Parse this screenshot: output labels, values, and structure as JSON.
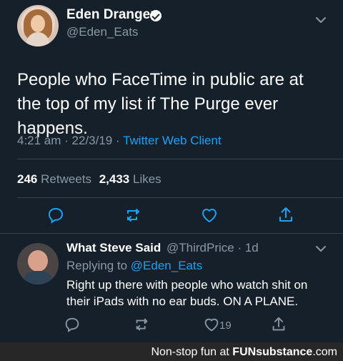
{
  "tweet": {
    "author_name": "Eden Dranger",
    "author_handle": "@Eden_Eats",
    "text": "People who FaceTime in public are at the top of my list if The Purge ever happens.",
    "timestamp": "4:21 am · 22/3/19 ·",
    "client": "Twitter Web Client",
    "retweets_count": "246",
    "retweets_label": "Retweets",
    "likes_count": "2,433",
    "likes_label": "Likes",
    "actions": [
      "reply-icon",
      "retweet-icon",
      "heart-icon",
      "share-icon"
    ]
  },
  "reply": {
    "author_name": "What Steve Said",
    "author_handle": "@ThirdPrice · 1d",
    "replying_label": "Replying to",
    "replying_to": "@Eden_Eats",
    "text": "Right up there with people who watch shit on their iPads with no ear buds. ON A PLANE.",
    "likes_count": "19",
    "actions": [
      "reply-icon",
      "retweet-icon",
      "heart-icon",
      "share-icon"
    ]
  },
  "footer": {
    "text_prefix": "Non-stop fun at",
    "brand_part1": "FUN",
    "brand_part2": "substance",
    "brand_suffix": ".com"
  },
  "colors": {
    "background": "#15202b",
    "accent": "#1da1f2",
    "muted": "#8899a6",
    "divider": "#38444d",
    "footer_bg": "#272727"
  }
}
